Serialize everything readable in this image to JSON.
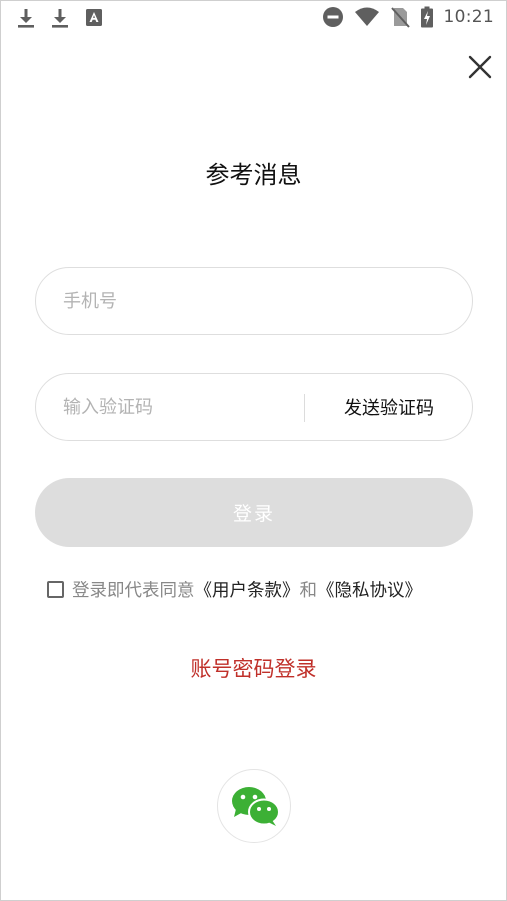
{
  "status_bar": {
    "time": "10:21",
    "left_icons": [
      "download-icon",
      "download-icon",
      "font-app-icon"
    ],
    "right_icons": [
      "do-not-disturb-icon",
      "wifi-icon",
      "no-sim-icon",
      "battery-charging-icon"
    ]
  },
  "page": {
    "title": "参考消息",
    "close_icon": "close-icon"
  },
  "form": {
    "phone_placeholder": "手机号",
    "phone_value": "",
    "code_placeholder": "输入验证码",
    "code_value": "",
    "send_code_label": "发送验证码",
    "login_label": "登录"
  },
  "agreement": {
    "checked": false,
    "prefix": "登录即代表同意",
    "terms_label": "《用户条款》",
    "and": "和",
    "privacy_label": "《隐私协议》"
  },
  "alt_login": {
    "password_login_label": "账号密码登录",
    "wechat_icon": "wechat-icon"
  },
  "colors": {
    "accent_red": "#c0302a",
    "wechat_green": "#3cb035",
    "disabled_button": "#dddddd"
  }
}
